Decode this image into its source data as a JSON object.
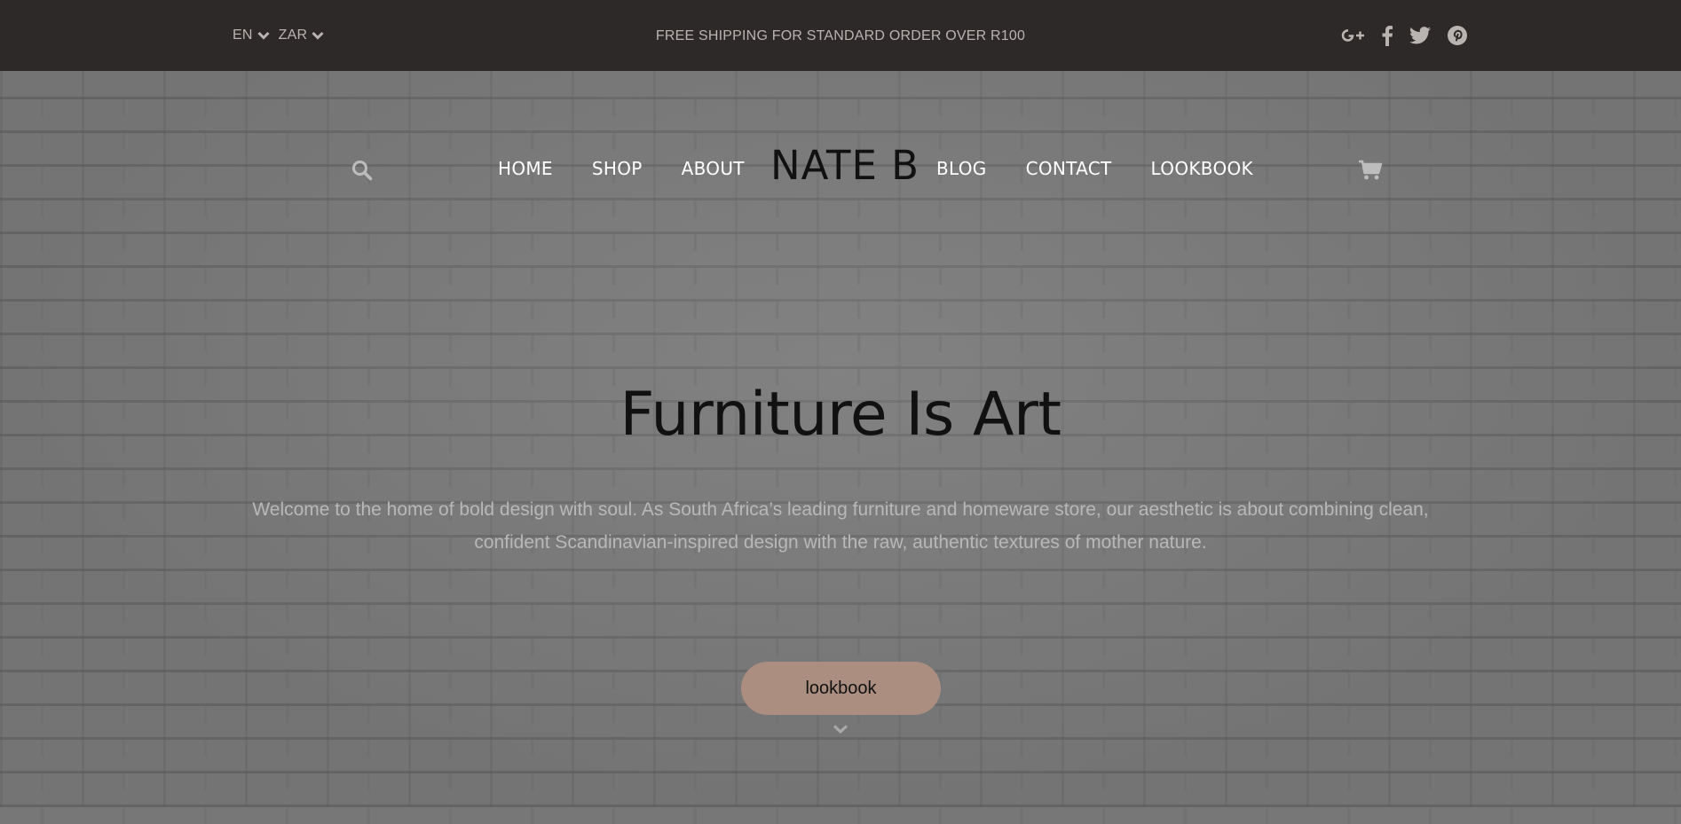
{
  "topbar": {
    "language": "EN",
    "currency": "ZAR",
    "promo": "FREE SHIPPING FOR STANDARD ORDER OVER R100",
    "social_icons": [
      "google-plus-icon",
      "facebook-icon",
      "twitter-icon",
      "pinterest-icon"
    ]
  },
  "nav": {
    "left": [
      "HOME",
      "SHOP",
      "ABOUT"
    ],
    "logo": "NATE B",
    "right": [
      "BLOG",
      "CONTACT",
      "LOOKBOOK"
    ],
    "icons": [
      "search-icon",
      "cart-icon"
    ]
  },
  "hero": {
    "title": "Furniture Is Art",
    "text": "Welcome to the home of bold design with soul. As South Africa’s leading furniture and homeware store, our aesthetic is about combining clean, confident Scandinavian-inspired design with the raw, authentic textures of mother nature.",
    "button": "lookbook",
    "scroll_icon": "chevron-down-icon"
  },
  "colors": {
    "topbar_bg": "#2e2929",
    "topbar_text": "#b9b4b1",
    "accent_button": "#ab8e80",
    "hero_text": "#b8b8b8"
  }
}
